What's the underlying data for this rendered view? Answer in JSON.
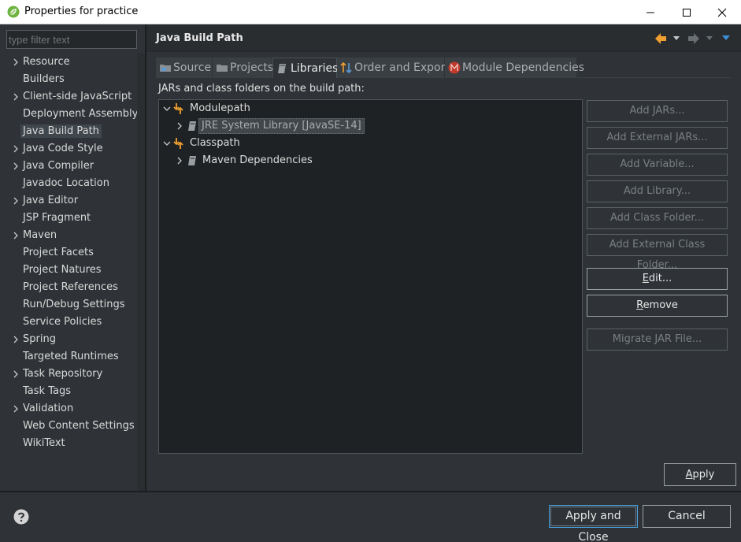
{
  "window": {
    "title": "Properties for practice",
    "controls": [
      "minimize",
      "maximize",
      "close"
    ]
  },
  "sidebar": {
    "filter_placeholder": "type filter text",
    "items": [
      {
        "label": "Resource",
        "expandable": true
      },
      {
        "label": "Builders",
        "expandable": false
      },
      {
        "label": "Client-side JavaScript",
        "expandable": true
      },
      {
        "label": "Deployment Assembly",
        "expandable": false
      },
      {
        "label": "Java Build Path",
        "expandable": false,
        "selected": true
      },
      {
        "label": "Java Code Style",
        "expandable": true
      },
      {
        "label": "Java Compiler",
        "expandable": true
      },
      {
        "label": "Javadoc Location",
        "expandable": false
      },
      {
        "label": "Java Editor",
        "expandable": true
      },
      {
        "label": "JSP Fragment",
        "expandable": false
      },
      {
        "label": "Maven",
        "expandable": true
      },
      {
        "label": "Project Facets",
        "expandable": false
      },
      {
        "label": "Project Natures",
        "expandable": false
      },
      {
        "label": "Project References",
        "expandable": false
      },
      {
        "label": "Run/Debug Settings",
        "expandable": false
      },
      {
        "label": "Service Policies",
        "expandable": false
      },
      {
        "label": "Spring",
        "expandable": true
      },
      {
        "label": "Targeted Runtimes",
        "expandable": false
      },
      {
        "label": "Task Repository",
        "expandable": true
      },
      {
        "label": "Task Tags",
        "expandable": false
      },
      {
        "label": "Validation",
        "expandable": true
      },
      {
        "label": "Web Content Settings",
        "expandable": false
      },
      {
        "label": "WikiText",
        "expandable": false
      }
    ]
  },
  "page": {
    "title": "Java Build Path",
    "description": "JARs and class folders on the build path:",
    "tabs": [
      {
        "label": "Source",
        "icon": "source-folder-icon"
      },
      {
        "label": "Projects",
        "icon": "projects-folder-icon"
      },
      {
        "label": "Libraries",
        "icon": "library-book-icon",
        "active": true
      },
      {
        "label": "Order and Export",
        "icon": "order-arrows-icon"
      },
      {
        "label": "Module Dependencies",
        "icon": "module-m-icon"
      }
    ],
    "tree": [
      {
        "label": "Modulepath",
        "expanded": true,
        "icon": "modulepath-icon",
        "level": 0
      },
      {
        "label": "JRE System Library [JavaSE-14]",
        "expanded": false,
        "icon": "library-icon",
        "level": 1,
        "selected": true
      },
      {
        "label": "Classpath",
        "expanded": true,
        "icon": "classpath-icon",
        "level": 0
      },
      {
        "label": "Maven Dependencies",
        "expanded": false,
        "icon": "library-icon",
        "level": 1
      }
    ],
    "buttons": {
      "add_jars": "Add JARs...",
      "add_external_jars": "Add External JARs...",
      "add_variable": "Add Variable...",
      "add_library": "Add Library...",
      "add_class_folder": "Add Class Folder...",
      "add_external_class_folder": "Add External Class Folder...",
      "edit_mnemonic": "E",
      "edit_rest": "dit...",
      "remove_mnemonic": "R",
      "remove_rest": "emove",
      "migrate_jar": "Migrate JAR File..."
    },
    "apply_mnemonic": "A",
    "apply_rest": "pply"
  },
  "footer": {
    "apply_and_close": "Apply and Close",
    "cancel": "Cancel"
  },
  "colors": {
    "background": "#2f3337",
    "tree_background": "#1f2224",
    "accent_orange": "#f0a030",
    "accent_blue": "#3c8fd8",
    "module_red": "#c0392b"
  }
}
